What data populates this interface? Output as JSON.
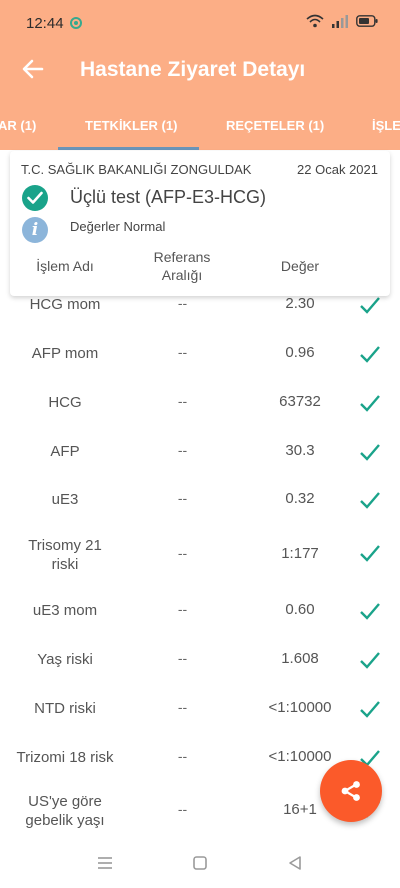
{
  "status": {
    "time": "12:44"
  },
  "header": {
    "title": "Hastane Ziyaret Detayı"
  },
  "tabs": [
    {
      "label": "AR (1)"
    },
    {
      "label": "TETKİKLER (1)"
    },
    {
      "label": "REÇETELER (1)"
    },
    {
      "label": "İŞLE"
    }
  ],
  "card": {
    "institution": "T.C. SAĞLIK BAKANLIĞI ZONGULDAK",
    "date": "22 Ocak 2021",
    "test_name": "Üçlü test (AFP-E3-HCG)",
    "info": "Değerler Normal",
    "columns": {
      "name": "İşlem Adı",
      "reference": "Referans Aralığı",
      "value": "Değer"
    }
  },
  "rows": [
    {
      "name": "HCG mom",
      "ref": "--",
      "value": "2.30"
    },
    {
      "name": "AFP mom",
      "ref": "--",
      "value": "0.96"
    },
    {
      "name": "HCG",
      "ref": "--",
      "value": "63732"
    },
    {
      "name": "AFP",
      "ref": "--",
      "value": "30.3"
    },
    {
      "name": "uE3",
      "ref": "--",
      "value": "0.32"
    },
    {
      "name": "Trisomy 21 riski",
      "ref": "--",
      "value": "1:177"
    },
    {
      "name": "uE3 mom",
      "ref": "--",
      "value": "0.60"
    },
    {
      "name": "Yaş riski",
      "ref": "--",
      "value": "1.608"
    },
    {
      "name": "NTD riski",
      "ref": "--",
      "value": "<1:10000"
    },
    {
      "name": "Trizomi 18 risk",
      "ref": "--",
      "value": "<1:10000"
    },
    {
      "name": "US'ye göre gebelik yaşı",
      "ref": "--",
      "value": "16+1"
    }
  ],
  "icons": {
    "back": "arrow-left-icon",
    "ok": "check-circle-icon",
    "info": "info-icon",
    "row_check": "check-icon",
    "share": "share-icon"
  },
  "colors": {
    "header_bg": "#fcae86",
    "accent_teal": "#1aa38a",
    "fab": "#fb5a2a",
    "tab_indicator": "#6a94b8",
    "info_blue": "#8cb5da"
  }
}
